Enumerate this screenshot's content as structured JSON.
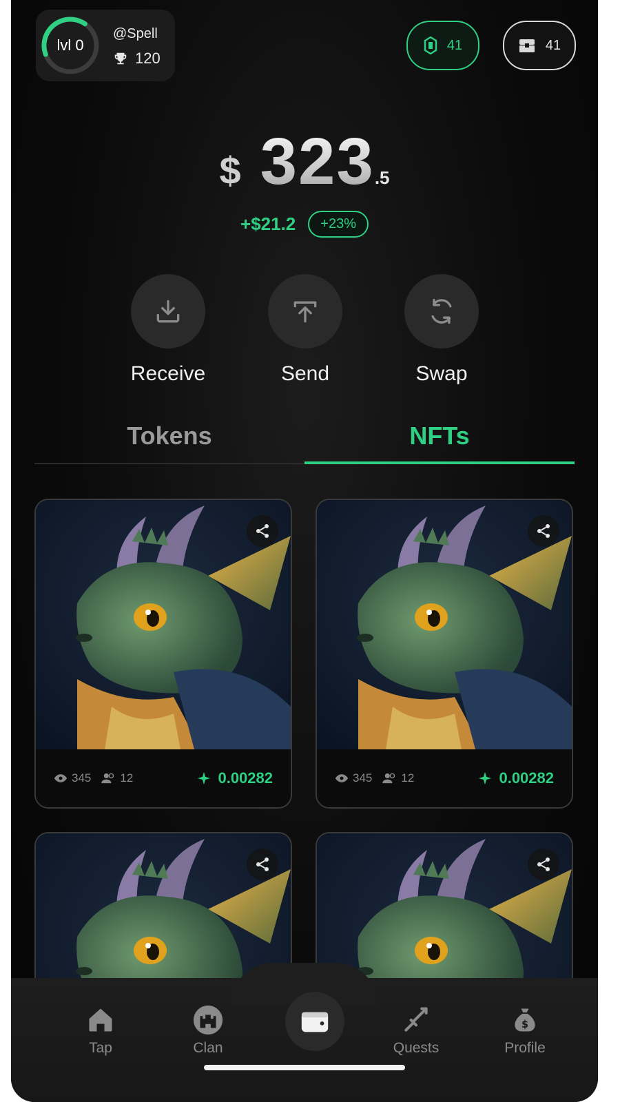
{
  "header": {
    "level_label": "lvl 0",
    "level_progress": 0.4,
    "username": "@Spell",
    "trophies": "120",
    "gems": "41",
    "chests": "41"
  },
  "balance": {
    "currency": "$",
    "amount": "323",
    "decimal": ".5",
    "change": "+$21.2",
    "change_percent": "+23%"
  },
  "actions": [
    {
      "label": "Receive",
      "icon": "download-icon"
    },
    {
      "label": "Send",
      "icon": "upload-icon"
    },
    {
      "label": "Swap",
      "icon": "refresh-icon"
    }
  ],
  "tabs": {
    "tokens": "Tokens",
    "nfts": "NFTs",
    "active": "nfts"
  },
  "nfts": [
    {
      "views": "345",
      "holders": "12",
      "price": "0.00282"
    },
    {
      "views": "345",
      "holders": "12",
      "price": "0.00282"
    },
    {
      "views": "",
      "holders": "",
      "price": ""
    },
    {
      "views": "",
      "holders": "",
      "price": ""
    }
  ],
  "nav": [
    {
      "label": "Tap",
      "icon": "home-icon"
    },
    {
      "label": "Clan",
      "icon": "castle-icon"
    },
    {
      "label": "",
      "icon": "wallet-icon"
    },
    {
      "label": "Quests",
      "icon": "sword-icon"
    },
    {
      "label": "Profile",
      "icon": "money-bag-icon"
    }
  ],
  "colors": {
    "accent": "#2fd084",
    "background": "#0b0b0b",
    "surface": "#2a2a2a"
  }
}
